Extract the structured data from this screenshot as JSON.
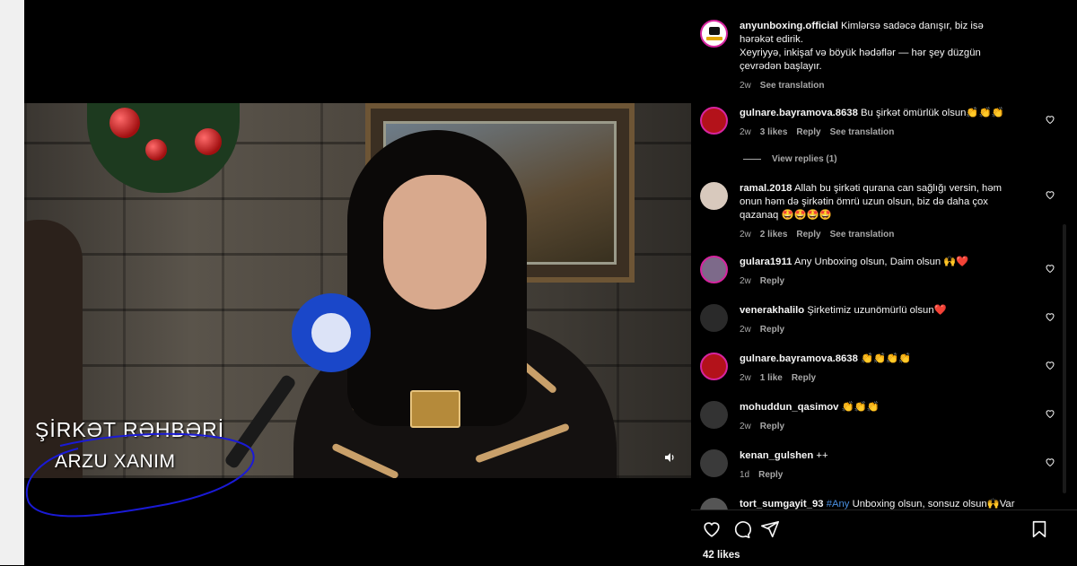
{
  "video": {
    "caption_title": "ŞİRKƏT RƏHBƏRİ",
    "caption_name": "ARZU XANIM",
    "volume_icon": "speaker-icon",
    "scribble_color": "#1a1ad6"
  },
  "post": {
    "username": "anyunboxing.official",
    "caption_line1": "Kimlərsə sadəcə danışır, biz isə hərəkət edirik.",
    "caption_line2": "Xeyriyyə, inkişaf və böyük hədəflər — hər şey düzgün çevrədən başlayır.",
    "age": "2w",
    "see_translation": "See translation"
  },
  "comments": [
    {
      "username": "gulnare.bayramova.8638",
      "text": "Bu şirkət ömürlük olsun👏👏👏",
      "age": "2w",
      "likes": "3 likes",
      "reply": "Reply",
      "translation": "See translation",
      "view_replies": "View replies (1)"
    },
    {
      "username": "ramal.2018",
      "text": "Allah bu şirkəti qurana can sağlığı versin, həm onun həm də şirkətin ömrü uzun olsun, biz də daha çox qazanaq 🤩🤩🤩🤩",
      "age": "2w",
      "likes": "2 likes",
      "reply": "Reply",
      "translation": "See translation"
    },
    {
      "username": "gulara1911",
      "text": "Any Unboxing olsun, Daim olsun 🙌❤️",
      "age": "2w",
      "reply": "Reply"
    },
    {
      "username": "venerakhalilo",
      "text": "Şirketimiz uzunömürlü olsun❤️",
      "age": "2w",
      "reply": "Reply"
    },
    {
      "username": "gulnare.bayramova.8638",
      "text": "👏👏👏👏",
      "age": "2w",
      "likes": "1 like",
      "reply": "Reply"
    },
    {
      "username": "mohuddun_qasimov",
      "text": "👏👏👏",
      "age": "2w",
      "reply": "Reply"
    },
    {
      "username": "kenan_gulshen",
      "text": "++",
      "age": "1d",
      "reply": "Reply"
    },
    {
      "username": "tort_sumgayit_93",
      "hashtag": "#Any",
      "text": " Unboxing olsun, sonsuz olsun🙌Var"
    }
  ],
  "actions": {
    "like_icon": "heart-icon",
    "comment_icon": "comment-icon",
    "share_icon": "share-icon",
    "save_icon": "bookmark-icon",
    "likes_count": "42 likes"
  }
}
